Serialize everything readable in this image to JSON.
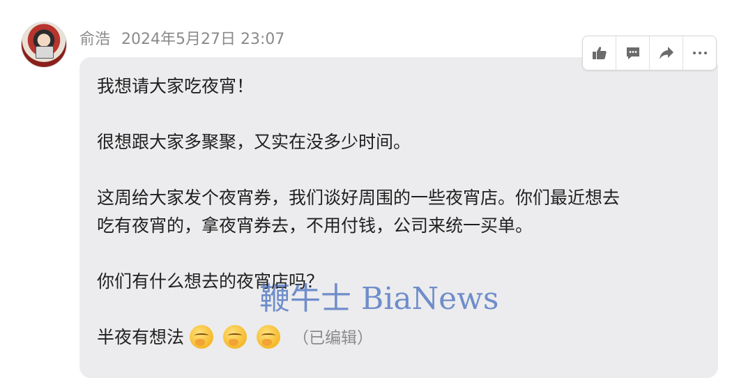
{
  "post": {
    "author": "俞浩",
    "timestamp": "2024年5月27日 23:07",
    "lines": [
      "我想请大家吃夜宵！",
      "很想跟大家多聚聚，又实在没多少时间。",
      "这周给大家发个夜宵券，我们谈好周围的一些夜宵店。你们最近想去",
      "吃有夜宵的，拿夜宵券去，不用付钱，公司来统一买单。",
      "你们有什么想去的夜宵店吗？",
      "半夜有想法"
    ],
    "emojis": [
      "hand-over-mouth-emoji",
      "hand-over-mouth-emoji",
      "hand-over-mouth-emoji"
    ],
    "edited_label": "（已编辑）"
  },
  "toolbar": {
    "icons": [
      "thumbs-up-icon",
      "comment-icon",
      "share-icon",
      "more-icon"
    ]
  },
  "watermark": {
    "text": "鞭牛士 BiaNews"
  },
  "colors": {
    "bubble": "#ececee",
    "meta_text": "#8a8a8a",
    "watermark": "#466ebe"
  }
}
